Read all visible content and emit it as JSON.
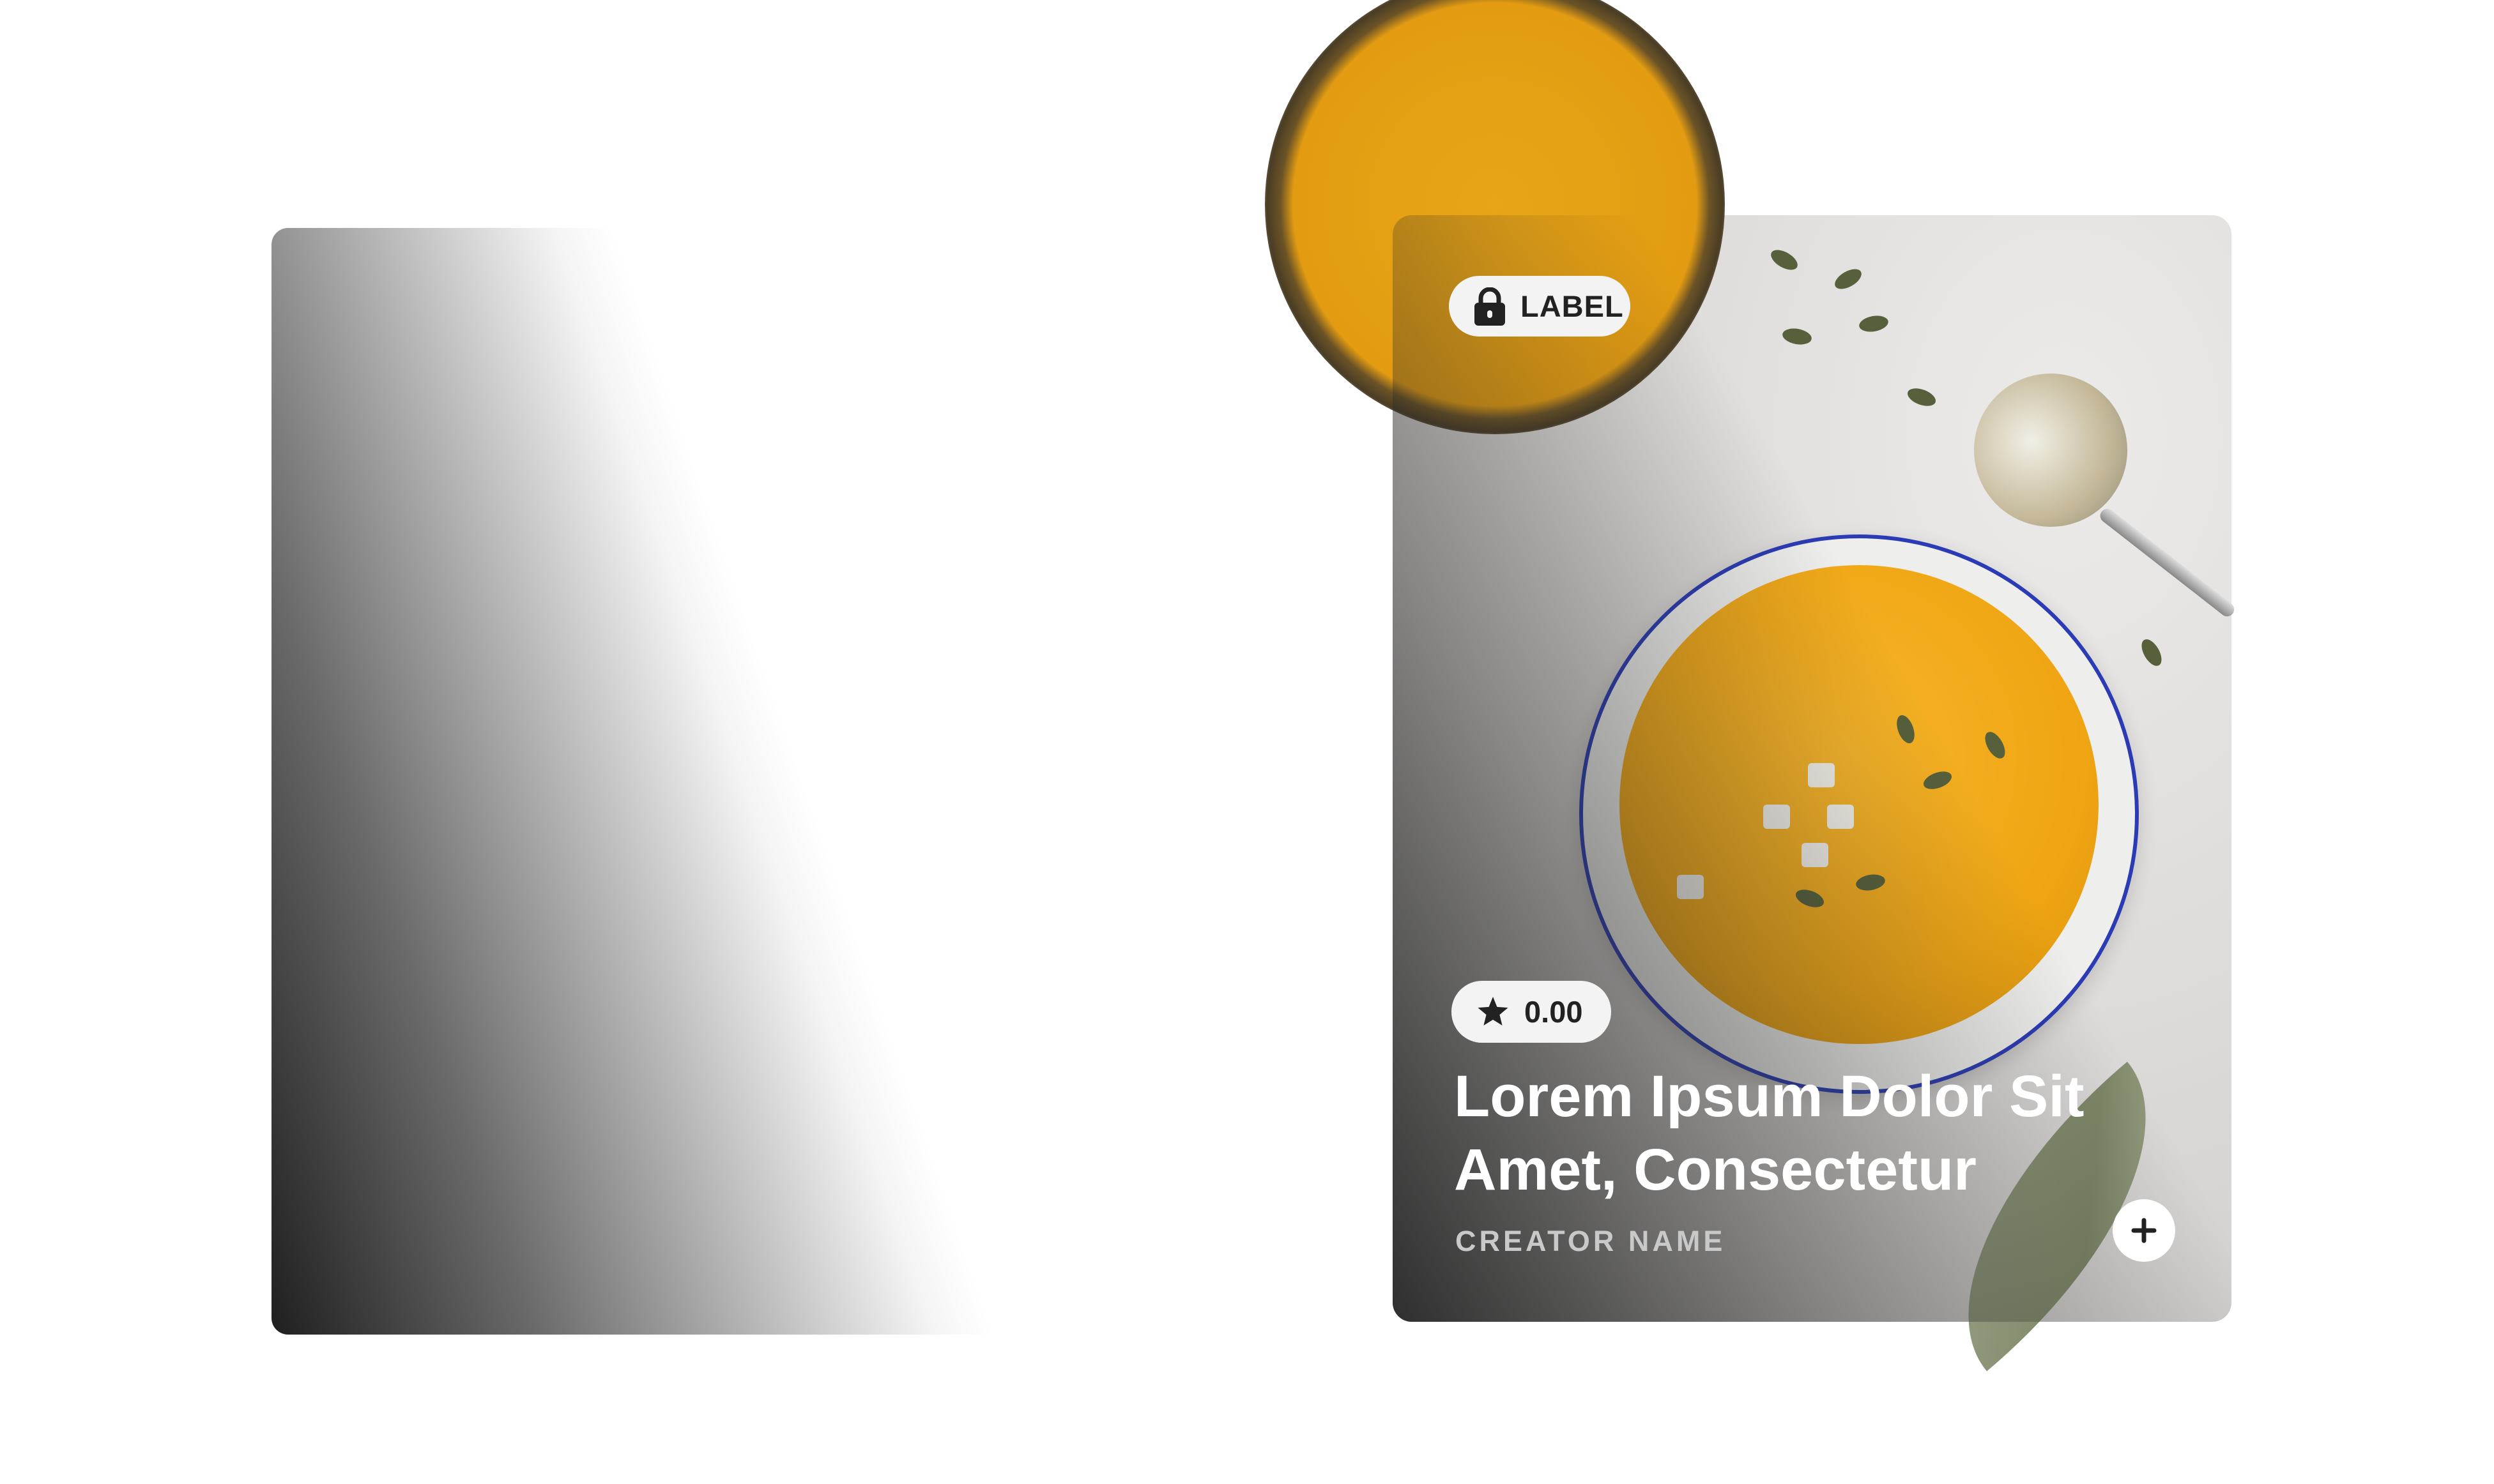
{
  "card": {
    "badge_label": "LABEL",
    "badge_icon": "lock-icon",
    "rating": "0.00",
    "rating_icon": "star-icon",
    "title": "Lorem Ipsum Dolor Sit Amet, Consectetur",
    "creator": "CREATOR NAME",
    "add_icon": "plus-icon"
  }
}
